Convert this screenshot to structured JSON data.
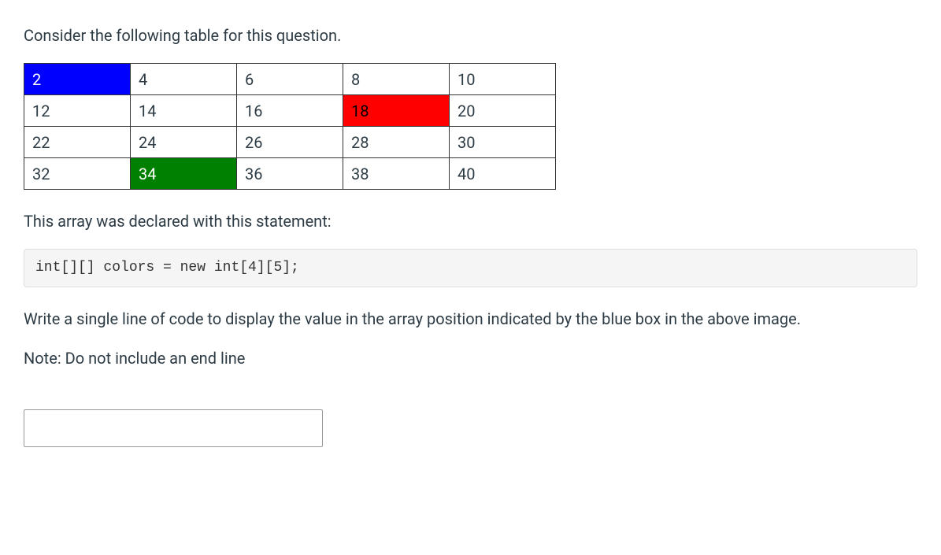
{
  "intro_text": "Consider the following table for this question.",
  "table": {
    "rows": [
      [
        {
          "v": "2",
          "color": "blue"
        },
        {
          "v": "4"
        },
        {
          "v": "6"
        },
        {
          "v": "8"
        },
        {
          "v": "10"
        }
      ],
      [
        {
          "v": "12"
        },
        {
          "v": "14"
        },
        {
          "v": "16"
        },
        {
          "v": "18",
          "color": "red"
        },
        {
          "v": "20"
        }
      ],
      [
        {
          "v": "22"
        },
        {
          "v": "24"
        },
        {
          "v": "26"
        },
        {
          "v": "28"
        },
        {
          "v": "30"
        }
      ],
      [
        {
          "v": "32"
        },
        {
          "v": "34",
          "color": "green"
        },
        {
          "v": "36"
        },
        {
          "v": "38"
        },
        {
          "v": "40"
        }
      ]
    ]
  },
  "declaration_text": "This array was declared with this statement:",
  "code_line": "int[][] colors = new int[4][5];",
  "instruction_text": "Write a single line of code to display the value in the array position indicated by the blue box in the above image.",
  "note_text": "Note: Do not include an end line",
  "answer_value": ""
}
